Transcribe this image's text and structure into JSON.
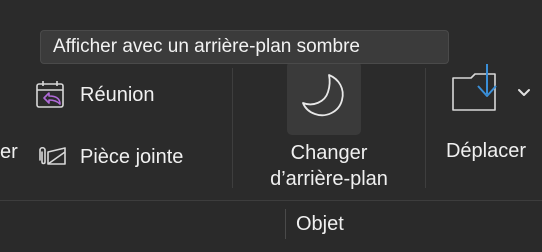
{
  "tooltip": {
    "text": "Afficher avec un arrière-plan sombre"
  },
  "ribbon": {
    "partial_label": "er",
    "reunion": {
      "label": "Réunion",
      "icon": "calendar-reply-icon"
    },
    "piece_jointe": {
      "label": "Pièce jointe",
      "icon": "paperclip-attach-icon"
    },
    "background": {
      "label_line1": "Changer",
      "label_line2": "d’arrière-plan",
      "icon": "moon-icon"
    },
    "move": {
      "label": "Déplacer",
      "icon": "move-to-folder-icon"
    }
  },
  "group": {
    "label": "Objet"
  },
  "colors": {
    "background": "#2b2b2b",
    "text": "#f0f0f0",
    "accent_blue": "#3a8fd8",
    "accent_purple": "#b06ad8",
    "button_bg": "#3a3a3a"
  }
}
